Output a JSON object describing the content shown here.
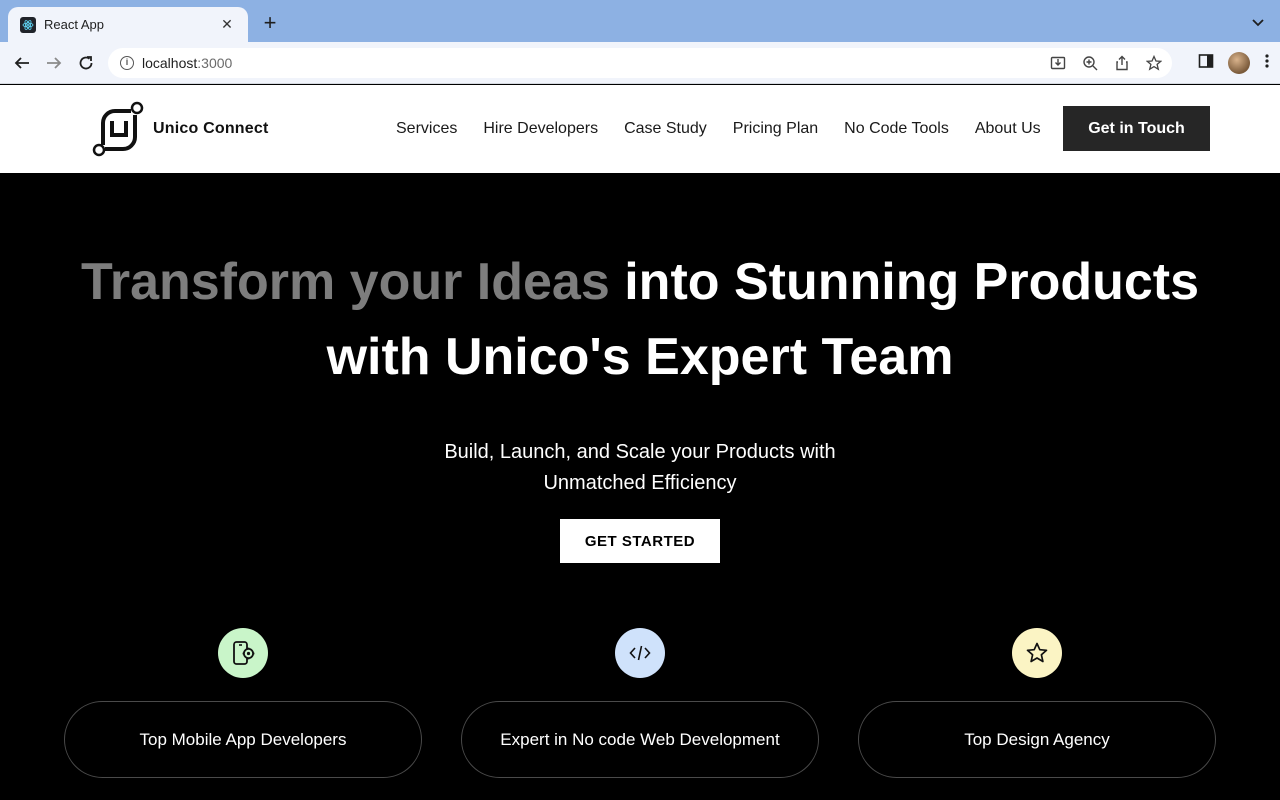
{
  "browser": {
    "tab_title": "React App",
    "url_host": "localhost",
    "url_port": ":3000"
  },
  "header": {
    "logo_text": "Unico Connect",
    "nav": [
      "Services",
      "Hire Developers",
      "Case Study",
      "Pricing Plan",
      "No Code Tools",
      "About Us"
    ],
    "cta_label": "Get in Touch"
  },
  "hero": {
    "title_muted": "Transform your Ideas",
    "title_rest_line1": " into Stunning Products",
    "title_line2": "with Unico's Expert Team",
    "subtitle_line1": "Build, Launch, and Scale your Products with",
    "subtitle_line2": "Unmatched Efficiency",
    "button_label": "GET STARTED"
  },
  "features": [
    {
      "label": "Top Mobile App Developers",
      "icon": "mobile-settings-icon",
      "icon_bg": "#c9f5c9"
    },
    {
      "label": "Expert in No code Web Development",
      "icon": "code-icon",
      "icon_bg": "#cfe2fb"
    },
    {
      "label": "Top Design Agency",
      "icon": "star-icon",
      "icon_bg": "#fbf4c4"
    }
  ],
  "colors": {
    "header_bg": "#ffffff",
    "hero_bg": "#000000",
    "cta_bg": "#262626",
    "muted_title": "#7d7d7d",
    "tabstrip": "#8db1e3"
  }
}
